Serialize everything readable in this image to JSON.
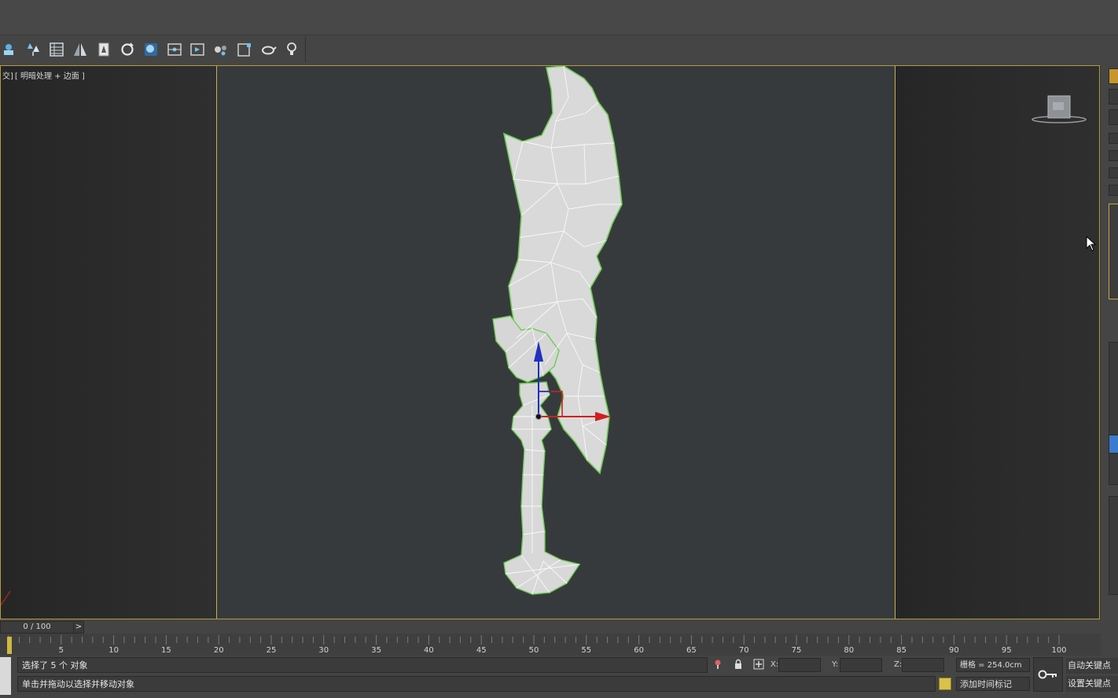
{
  "viewport": {
    "label_prefix": "交]",
    "label_mode": "[ 明暗处理 + 边面 ]"
  },
  "toolbar": {
    "tools": [
      "select-object-icon",
      "select-by-name-icon",
      "layer-explorer-icon",
      "mirror-icon",
      "align-icon",
      "rotate-icon",
      "material-editor-icon",
      "render-setup-icon",
      "render-frame-icon",
      "render-production-icon",
      "frame-icon",
      "teapot-icon",
      "light-bulb-icon"
    ]
  },
  "timeline": {
    "frame_display": "0 / 100",
    "next_label": ">",
    "current_frame": 0,
    "total_frames": 100,
    "ruler_labels": [
      "5",
      "10",
      "15",
      "20",
      "25",
      "30",
      "35",
      "40",
      "45",
      "50",
      "55",
      "60",
      "65",
      "70",
      "75",
      "80",
      "85",
      "90",
      "95",
      "100"
    ]
  },
  "status": {
    "selection": "选择了 5 个 对象",
    "prompt": "单击并拖动以选择并移动对象",
    "x_label": "X:",
    "y_label": "Y:",
    "z_label": "Z:",
    "x_value": "",
    "y_value": "",
    "z_value": "",
    "grid": "栅格 = 254.0cm",
    "add_time_tag": "添加时间标记",
    "auto_key": "自动关键点",
    "set_key": "设置关键点"
  },
  "colors": {
    "viewport_border": "#c9b147",
    "x_axis": "#d02020",
    "y_axis": "#2030c0",
    "selection_outline": "#5ad24a"
  }
}
